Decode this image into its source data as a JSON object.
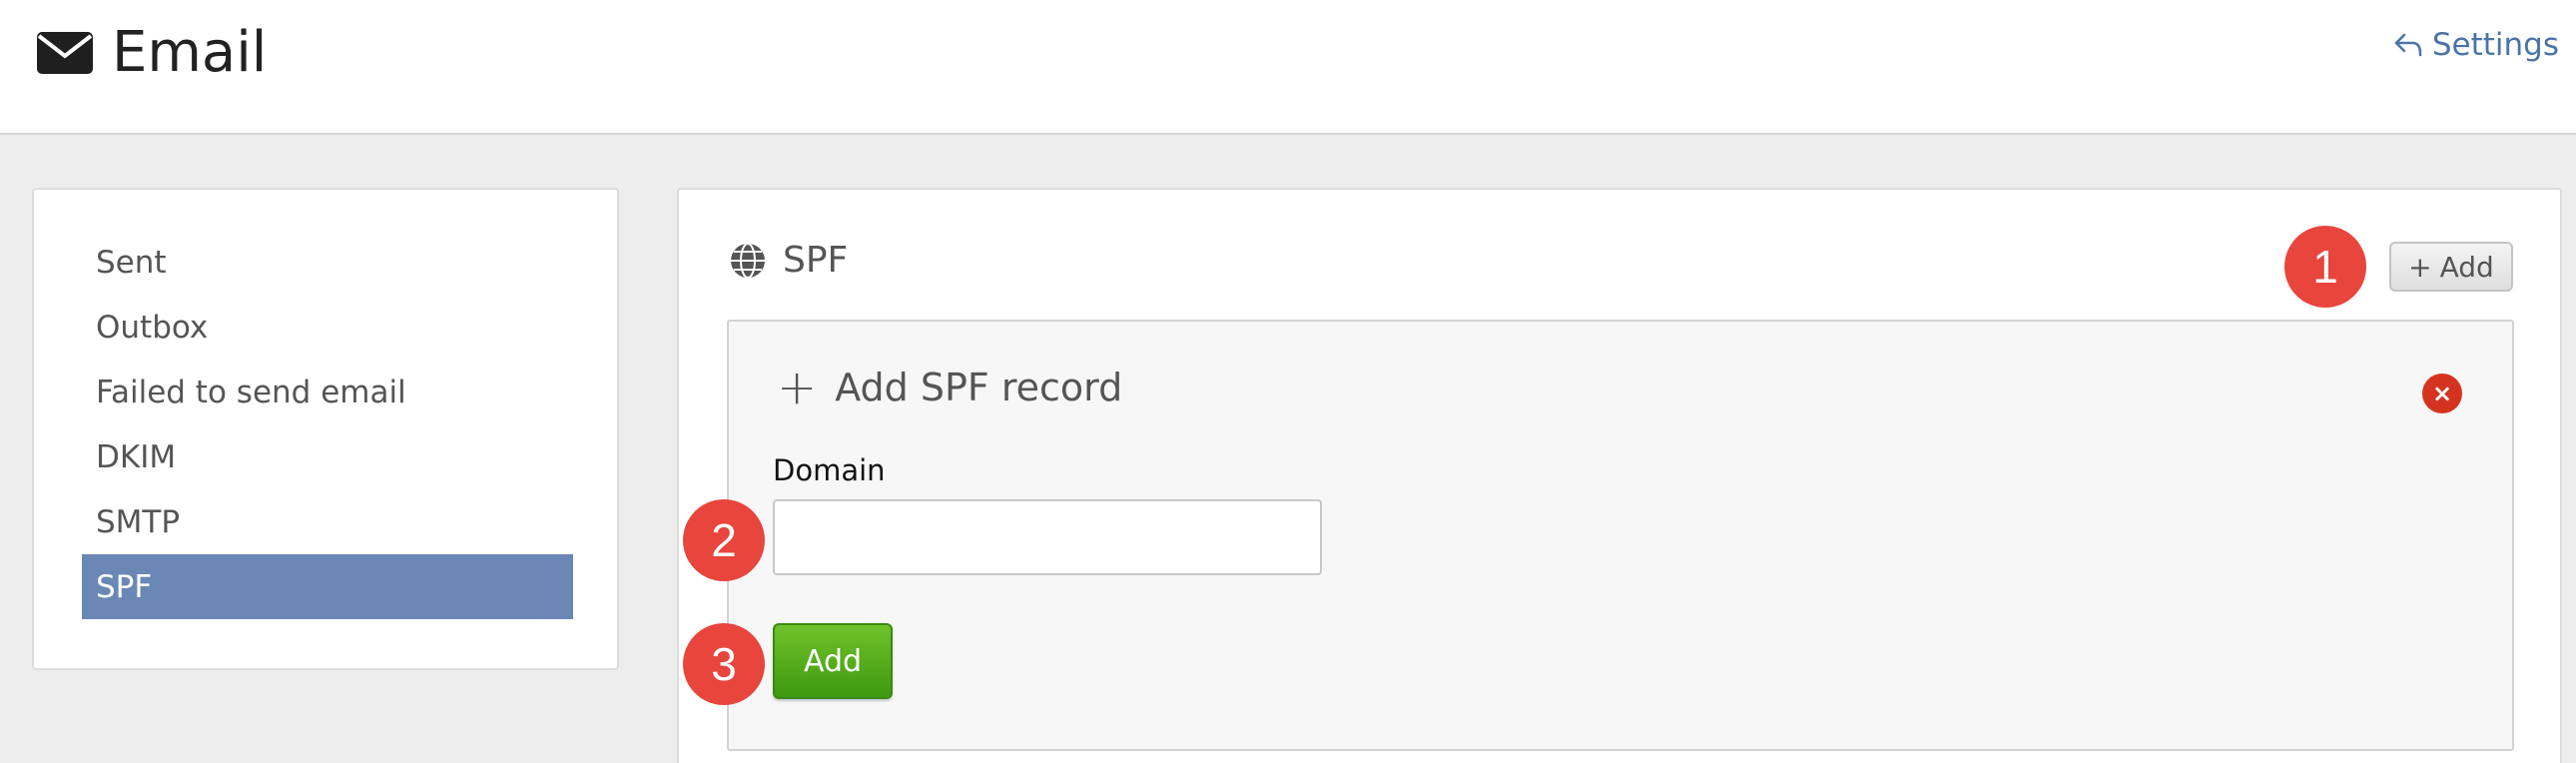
{
  "header": {
    "title": "Email",
    "settings_label": "Settings"
  },
  "sidebar": {
    "items": [
      {
        "label": "Sent"
      },
      {
        "label": "Outbox"
      },
      {
        "label": "Failed to send email"
      },
      {
        "label": "DKIM"
      },
      {
        "label": "SMTP"
      },
      {
        "label": "SPF",
        "active": true
      }
    ]
  },
  "main": {
    "title": "SPF",
    "add_button_label": "Add",
    "form": {
      "title": "Add SPF record",
      "close_glyph": "×",
      "domain_label": "Domain",
      "domain_value": "",
      "submit_label": "Add"
    }
  },
  "steps": [
    "1",
    "2",
    "3"
  ],
  "icons": {
    "header": "envelope-icon",
    "settings": "reply-arrow-icon",
    "panel": "globe-icon",
    "close": "close-icon"
  },
  "colors": {
    "active_sidebar": "#6b87b5",
    "link": "#4a74a8",
    "step_badge": "#e8453c",
    "close": "#d4341f",
    "submit": "#4fab18"
  }
}
